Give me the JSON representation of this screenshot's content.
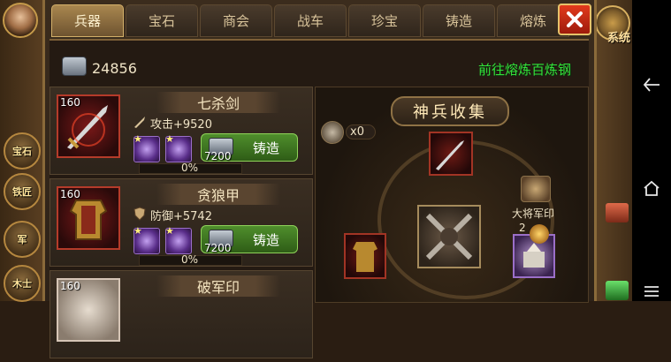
{
  "tabs": [
    {
      "label": "兵器",
      "active": true
    },
    {
      "label": "宝石",
      "active": false
    },
    {
      "label": "商会",
      "active": false
    },
    {
      "label": "战车",
      "active": false
    },
    {
      "label": "珍宝",
      "active": false
    },
    {
      "label": "铸造",
      "active": false
    },
    {
      "label": "熔炼",
      "active": false
    }
  ],
  "close_icon": "close-icon",
  "header": {
    "currency_icon": "iron-ingot-icon",
    "currency_amount": "24856",
    "goto_link": "前往熔炼百炼钢"
  },
  "items": [
    {
      "level": "160",
      "name": "七杀剑",
      "stat_icon": "sword-icon",
      "stat": "攻击+9520",
      "cost": "7200",
      "forge_label": "铸造",
      "progress_text": "0%",
      "progress": 0
    },
    {
      "level": "160",
      "name": "贪狼甲",
      "stat_icon": "shield-icon",
      "stat": "防御+5742",
      "cost": "7200",
      "forge_label": "铸造",
      "progress_text": "0%",
      "progress": 0
    },
    {
      "level": "160",
      "name": "破军印"
    }
  ],
  "collection": {
    "title": "神兵收集",
    "hammer_count": "x0",
    "seal_label": "大将军印",
    "seal_count": "2"
  },
  "left_hud": [
    "宝石",
    "铁匠",
    "军",
    "木士"
  ],
  "right_hud_label": "系统",
  "colors": {
    "accent_green": "#34e03a",
    "tab_active": "#a9874f",
    "close_red": "#e23a1c",
    "forge_green": "#4f8e2c"
  }
}
